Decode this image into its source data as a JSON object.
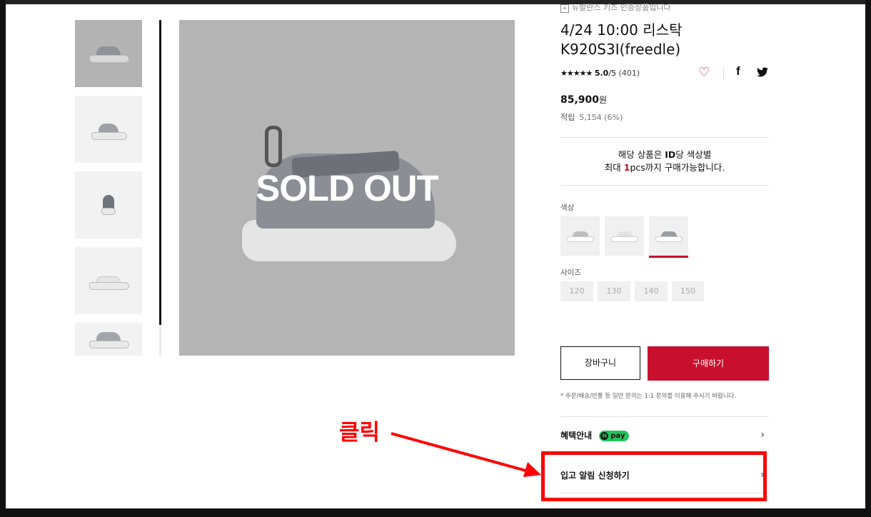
{
  "top_notice": "뉴발란스 키즈 인증상품입니다",
  "thumbnails": [
    {
      "name": "thumb-1"
    },
    {
      "name": "thumb-2"
    },
    {
      "name": "thumb-3"
    },
    {
      "name": "thumb-4"
    },
    {
      "name": "thumb-5"
    }
  ],
  "main_image": {
    "overlay_text": "SOLD OUT"
  },
  "product": {
    "title_line1": "4/24 10:00 리스탁",
    "title_line2": "K920S3I(freedle)",
    "stars": "★★★★★",
    "score": "5.0",
    "score_max": "/5",
    "review_count": "(401)",
    "price": "85,900",
    "price_unit": "원",
    "points_label": "적립",
    "points_value": "5,154 (6%)"
  },
  "purchase_limit": {
    "line1_pre": "해당 상품은 ",
    "line1_bold": "ID",
    "line1_post": "당 색상별",
    "line2_pre": "최대 ",
    "line2_red": "1",
    "line2_post": "pcs까지 구매가능합니다."
  },
  "color_label": "색상",
  "size_label": "사이즈",
  "sizes": [
    "120",
    "130",
    "140",
    "150"
  ],
  "buttons": {
    "cart": "장바구니",
    "buy": "구매하기"
  },
  "footnote": "* 주문/배송/반품 등 일반 문의는 1:1 문의를 이용해 주시기 바랍니다.",
  "benefit": {
    "label": "혜택안내",
    "npay": "pay",
    "npay_n": "N"
  },
  "restock": {
    "label": "입고 알림 신청하기"
  },
  "annotation": {
    "text": "클릭"
  },
  "colors": {
    "accent": "#c8102e",
    "annotation": "#ff0000",
    "npay": "#23c45a"
  }
}
